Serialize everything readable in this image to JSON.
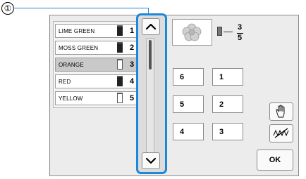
{
  "callout": {
    "number": "①"
  },
  "colors": [
    {
      "name": "LIME GREEN",
      "number": "1",
      "spool": "dark",
      "selected": false
    },
    {
      "name": "MOSS GREEN",
      "number": "2",
      "spool": "dark",
      "selected": false
    },
    {
      "name": "ORANGE",
      "number": "3",
      "spool": "light",
      "selected": true
    },
    {
      "name": "RED",
      "number": "4",
      "spool": "dark",
      "selected": false
    },
    {
      "name": "YELLOW",
      "number": "5",
      "spool": "light",
      "selected": false
    }
  ],
  "thread_counter": {
    "current": "3",
    "total": "5"
  },
  "needles": [
    "6",
    "1",
    "5",
    "2",
    "4",
    "3"
  ],
  "buttons": {
    "ok": "OK"
  },
  "icons": {
    "scroll_up": "chevron-up-icon",
    "scroll_down": "chevron-down-icon",
    "hand": "hand-icon",
    "thread_cut": "thread-cut-icon",
    "preview": "embroidery-pattern-icon",
    "spool": "thread-spool-icon"
  },
  "accent_color": "#1e88d8"
}
